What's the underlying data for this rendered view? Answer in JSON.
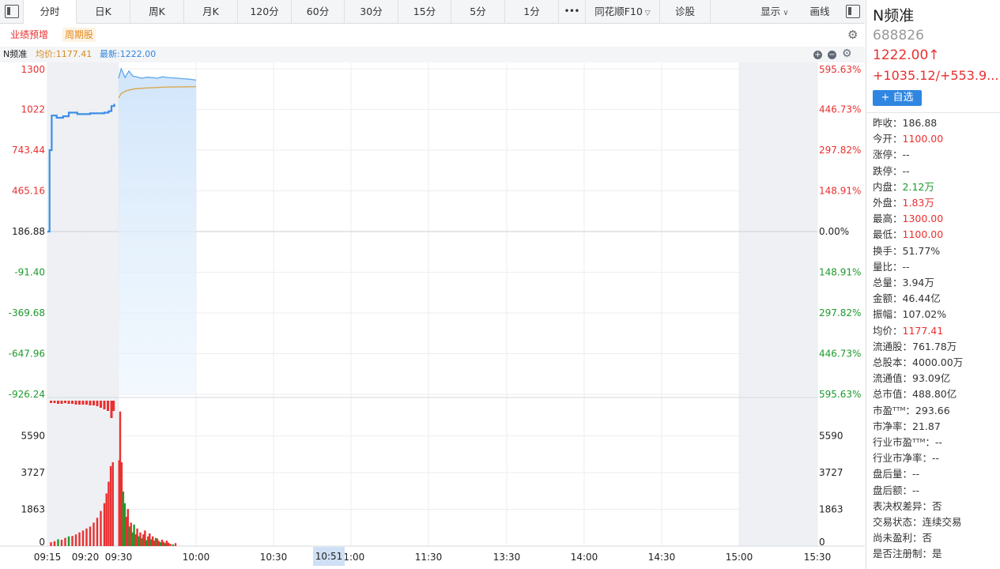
{
  "toolbar": {
    "tabs": [
      "分时",
      "日K",
      "周K",
      "月K",
      "120分",
      "60分",
      "30分",
      "15分",
      "5分",
      "1分"
    ],
    "more_label": "•••",
    "f10_label": "同花顺F10",
    "diagnose_label": "诊股",
    "display_label": "显示",
    "draw_label": "画线"
  },
  "tags": [
    "业绩预增",
    "周期股"
  ],
  "infobar": {
    "name": "N频准",
    "avg_label": "均价:1177.41",
    "latest_label": "最新:1222.00"
  },
  "colors": {
    "up": "#e93030",
    "down": "#1c9a2c",
    "price_line": "#3b8fe6",
    "avg_line": "#d8a850",
    "accent": "#2f86e0"
  },
  "chart_data": {
    "type": "line",
    "prev_close": 186.88,
    "price_axis": [
      "1300",
      "1022",
      "743.44",
      "465.16",
      "186.88",
      "-91.40",
      "-369.68",
      "-647.96",
      "-926.24"
    ],
    "pct_axis": [
      "595.63%",
      "446.73%",
      "297.82%",
      "148.91%",
      "0.00%",
      "148.91%",
      "297.82%",
      "446.73%",
      "595.63%"
    ],
    "volume_axis": [
      "5590",
      "3727",
      "1863",
      "0"
    ],
    "time_labels": [
      "09:15",
      "09:20",
      "09:30",
      "10:00",
      "10:30",
      "11:00",
      "11:30",
      "13:30",
      "14:00",
      "14:30",
      "15:00",
      "15:30"
    ],
    "cursor_time": "10:51",
    "auction_price": [
      [
        0,
        186.88
      ],
      [
        0.3,
        743.44
      ],
      [
        0.6,
        980
      ],
      [
        1.3,
        965
      ],
      [
        2.2,
        975
      ],
      [
        3.0,
        1000
      ],
      [
        4.2,
        990
      ],
      [
        6.0,
        995
      ],
      [
        8.0,
        1000
      ],
      [
        8.6,
        1010
      ],
      [
        9.0,
        1045
      ],
      [
        9.4,
        1060
      ]
    ],
    "price": [
      [
        10,
        1235
      ],
      [
        11,
        1300
      ],
      [
        12.5,
        1240
      ],
      [
        14,
        1285
      ],
      [
        15.5,
        1250
      ],
      [
        17,
        1245
      ],
      [
        19,
        1235
      ],
      [
        21,
        1242
      ],
      [
        23,
        1240
      ],
      [
        25,
        1235
      ],
      [
        27,
        1245
      ],
      [
        29,
        1240
      ],
      [
        31,
        1238
      ],
      [
        33,
        1235
      ],
      [
        35,
        1232
      ],
      [
        37,
        1230
      ],
      [
        40,
        1222
      ]
    ],
    "avg_price": [
      [
        10,
        1100
      ],
      [
        11,
        1130
      ],
      [
        13,
        1150
      ],
      [
        16,
        1162
      ],
      [
        20,
        1168
      ],
      [
        25,
        1172
      ],
      [
        30,
        1175
      ],
      [
        35,
        1176
      ],
      [
        40,
        1177.41
      ]
    ],
    "volume": [
      {
        "t": 0.5,
        "v": 200,
        "d": "up"
      },
      {
        "t": 1.0,
        "v": 250,
        "d": "up"
      },
      {
        "t": 1.5,
        "v": 350,
        "d": "down"
      },
      {
        "t": 2.0,
        "v": 320,
        "d": "up"
      },
      {
        "t": 2.5,
        "v": 420,
        "d": "up"
      },
      {
        "t": 3.0,
        "v": 500,
        "d": "down"
      },
      {
        "t": 3.5,
        "v": 520,
        "d": "up"
      },
      {
        "t": 4.0,
        "v": 600,
        "d": "up"
      },
      {
        "t": 4.5,
        "v": 700,
        "d": "up"
      },
      {
        "t": 5.0,
        "v": 800,
        "d": "up"
      },
      {
        "t": 5.5,
        "v": 900,
        "d": "up"
      },
      {
        "t": 6.0,
        "v": 1000,
        "d": "up"
      },
      {
        "t": 6.5,
        "v": 1200,
        "d": "up"
      },
      {
        "t": 7.0,
        "v": 1450,
        "d": "up"
      },
      {
        "t": 7.5,
        "v": 1800,
        "d": "up"
      },
      {
        "t": 8.0,
        "v": 2200,
        "d": "up"
      },
      {
        "t": 8.3,
        "v": 2700,
        "d": "up"
      },
      {
        "t": 8.6,
        "v": 3300,
        "d": "up"
      },
      {
        "t": 8.9,
        "v": 4100,
        "d": "up"
      },
      {
        "t": 9.2,
        "v": 4300,
        "d": "up"
      },
      {
        "t": 10.2,
        "v": 4400,
        "d": "up"
      },
      {
        "t": 10.6,
        "v": 6900,
        "d": "up"
      },
      {
        "t": 11.2,
        "v": 4300,
        "d": "up"
      },
      {
        "t": 11.8,
        "v": 2800,
        "d": "down"
      },
      {
        "t": 12.4,
        "v": 2200,
        "d": "down"
      },
      {
        "t": 13.0,
        "v": 1500,
        "d": "up"
      },
      {
        "t": 13.6,
        "v": 1900,
        "d": "up"
      },
      {
        "t": 14.2,
        "v": 1000,
        "d": "down"
      },
      {
        "t": 14.8,
        "v": 1200,
        "d": "up"
      },
      {
        "t": 15.4,
        "v": 700,
        "d": "down"
      },
      {
        "t": 16.0,
        "v": 1100,
        "d": "down"
      },
      {
        "t": 16.6,
        "v": 600,
        "d": "up"
      },
      {
        "t": 17.2,
        "v": 900,
        "d": "up"
      },
      {
        "t": 17.8,
        "v": 500,
        "d": "down"
      },
      {
        "t": 18.4,
        "v": 700,
        "d": "up"
      },
      {
        "t": 19.0,
        "v": 400,
        "d": "down"
      },
      {
        "t": 19.6,
        "v": 600,
        "d": "up"
      },
      {
        "t": 20.2,
        "v": 800,
        "d": "up"
      },
      {
        "t": 20.8,
        "v": 300,
        "d": "down"
      },
      {
        "t": 21.4,
        "v": 500,
        "d": "up"
      },
      {
        "t": 22.0,
        "v": 650,
        "d": "up"
      },
      {
        "t": 22.6,
        "v": 350,
        "d": "down"
      },
      {
        "t": 23.2,
        "v": 500,
        "d": "up"
      },
      {
        "t": 23.8,
        "v": 280,
        "d": "up"
      },
      {
        "t": 24.4,
        "v": 420,
        "d": "down"
      },
      {
        "t": 25.0,
        "v": 380,
        "d": "up"
      },
      {
        "t": 25.6,
        "v": 260,
        "d": "up"
      },
      {
        "t": 26.2,
        "v": 200,
        "d": "down"
      },
      {
        "t": 26.8,
        "v": 330,
        "d": "up"
      },
      {
        "t": 27.4,
        "v": 220,
        "d": "up"
      },
      {
        "t": 28.0,
        "v": 150,
        "d": "down"
      },
      {
        "t": 28.6,
        "v": 280,
        "d": "up"
      },
      {
        "t": 29.2,
        "v": 180,
        "d": "up"
      },
      {
        "t": 30.0,
        "v": 120,
        "d": "up"
      },
      {
        "t": 31.0,
        "v": 90,
        "d": "down"
      },
      {
        "t": 32.0,
        "v": 150,
        "d": "up"
      }
    ],
    "auction_imbalance": [
      {
        "t": 0.5,
        "v": 3
      },
      {
        "t": 1.0,
        "v": 3
      },
      {
        "t": 1.5,
        "v": 4
      },
      {
        "t": 2.0,
        "v": 4
      },
      {
        "t": 2.5,
        "v": 3
      },
      {
        "t": 3.0,
        "v": 4
      },
      {
        "t": 3.5,
        "v": 4
      },
      {
        "t": 4.0,
        "v": 5
      },
      {
        "t": 4.5,
        "v": 5
      },
      {
        "t": 5.0,
        "v": 5
      },
      {
        "t": 5.5,
        "v": 5
      },
      {
        "t": 6.0,
        "v": 6
      },
      {
        "t": 6.5,
        "v": 6
      },
      {
        "t": 7.0,
        "v": 7
      },
      {
        "t": 7.5,
        "v": 9
      },
      {
        "t": 8.0,
        "v": 11
      },
      {
        "t": 8.5,
        "v": 13
      },
      {
        "t": 9.0,
        "v": 22
      },
      {
        "t": 9.3,
        "v": 13
      }
    ]
  },
  "panel": {
    "name": "N频准",
    "code": "688826",
    "price": "1222.00↑",
    "change": "+1035.12/+553.9...",
    "add_watch": "+ 自选",
    "rows": [
      {
        "k": "昨收：",
        "v": "186.88",
        "c": ""
      },
      {
        "k": "今开：",
        "v": "1100.00",
        "c": "red"
      },
      {
        "k": "涨停：",
        "v": "--",
        "c": ""
      },
      {
        "k": "跌停：",
        "v": "--",
        "c": ""
      },
      {
        "k": "内盘：",
        "v": "2.12万",
        "c": "green"
      },
      {
        "k": "外盘：",
        "v": "1.83万",
        "c": "red"
      },
      {
        "k": "最高：",
        "v": "1300.00",
        "c": "red"
      },
      {
        "k": "最低：",
        "v": "1100.00",
        "c": "red"
      },
      {
        "k": "换手：",
        "v": "51.77%",
        "c": ""
      },
      {
        "k": "量比：",
        "v": "--",
        "c": ""
      },
      {
        "k": "总量：",
        "v": "3.94万",
        "c": ""
      },
      {
        "k": "金额：",
        "v": "46.44亿",
        "c": ""
      },
      {
        "k": "振幅：",
        "v": "107.02%",
        "c": ""
      },
      {
        "k": "均价：",
        "v": "1177.41",
        "c": "red"
      },
      {
        "k": "流通股：",
        "v": "761.78万",
        "c": ""
      },
      {
        "k": "总股本：",
        "v": "4000.00万",
        "c": ""
      },
      {
        "k": "流通值：",
        "v": "93.09亿",
        "c": ""
      },
      {
        "k": "总市值：",
        "v": "488.80亿",
        "c": ""
      },
      {
        "k": "市盈ᵀᵀᴹ：",
        "v": "293.66",
        "c": ""
      },
      {
        "k": "市净率：",
        "v": "21.87",
        "c": ""
      },
      {
        "k": "行业市盈ᵀᵀᴹ：",
        "v": "--",
        "c": ""
      },
      {
        "k": "行业市净率：",
        "v": "--",
        "c": ""
      },
      {
        "k": "盘后量：",
        "v": "--",
        "c": ""
      },
      {
        "k": "盘后额：",
        "v": "--",
        "c": ""
      },
      {
        "k": "表决权差异：",
        "v": "否",
        "c": ""
      },
      {
        "k": "交易状态：",
        "v": "连续交易",
        "c": ""
      },
      {
        "k": "尚未盈利：",
        "v": "否",
        "c": ""
      },
      {
        "k": "是否注册制：",
        "v": "是",
        "c": ""
      }
    ]
  }
}
